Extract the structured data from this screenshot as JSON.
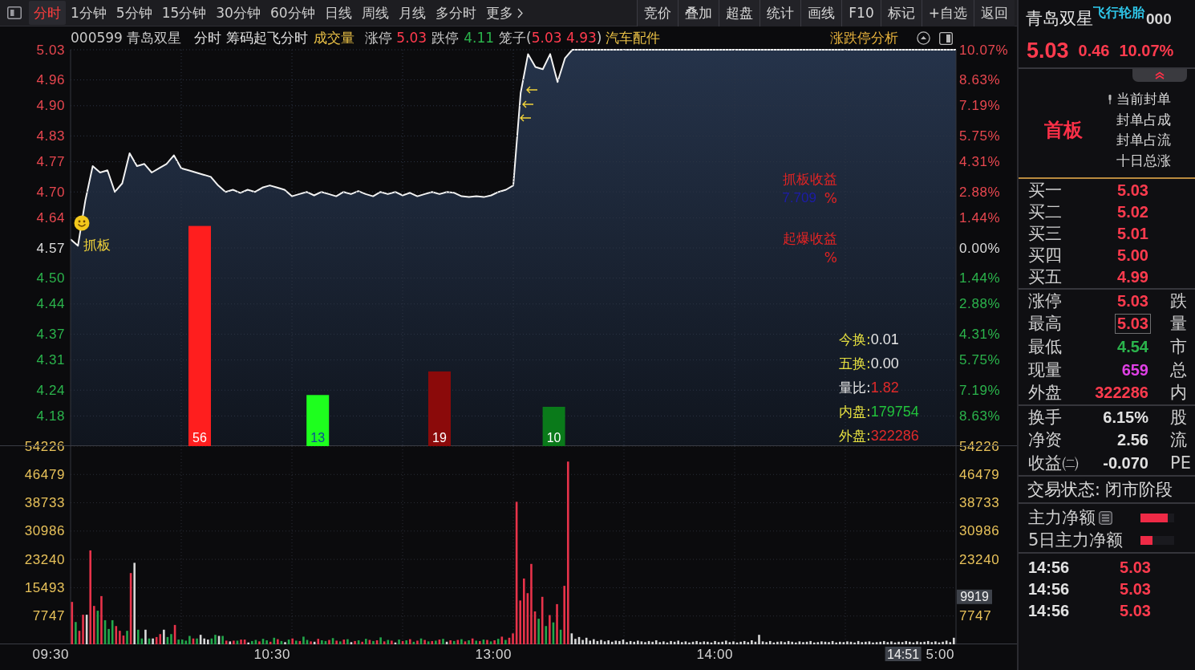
{
  "toolbar": {
    "periods": [
      {
        "label": "分时",
        "selected": true,
        "kind": "period"
      },
      {
        "label": "1分钟",
        "selected": false,
        "kind": "period"
      },
      {
        "label": "5分钟",
        "selected": false,
        "kind": "period"
      },
      {
        "label": "15分钟",
        "selected": false,
        "kind": "period"
      },
      {
        "label": "30分钟",
        "selected": false,
        "kind": "period"
      },
      {
        "label": "60分钟",
        "selected": false,
        "kind": "period"
      },
      {
        "label": "日线",
        "selected": false,
        "kind": "period"
      },
      {
        "label": "周线",
        "selected": false,
        "kind": "period"
      },
      {
        "label": "月线",
        "selected": false,
        "kind": "period"
      },
      {
        "label": "多分时",
        "selected": false,
        "kind": "period"
      },
      {
        "label": "更多",
        "selected": false,
        "kind": "menu"
      }
    ],
    "actions": [
      "竞价",
      "叠加",
      "超盘",
      "统计",
      "画线",
      "F10",
      "标记",
      "+自选",
      "返回"
    ]
  },
  "chart_header": {
    "code_name": "000599 青岛双星",
    "period": "分时",
    "indicator": "筹码起飞分时",
    "volume_label": "成交量",
    "limit_up_label": "涨停",
    "limit_up": "5.03",
    "limit_down_label": "跌停",
    "limit_down": "4.11",
    "cage": {
      "open": "笼子(",
      "high": "5.03",
      "low": "4.93",
      "close": ")"
    },
    "industry": "汽车配件",
    "analysis": "涨跌停分析"
  },
  "price_chart": {
    "chart_data": {
      "type": "area",
      "grid": true,
      "ylim": [
        4.11,
        5.03
      ],
      "yticks": [
        {
          "value": 5.03,
          "label": "5.03"
        },
        {
          "value": 4.96,
          "label": "4.96"
        },
        {
          "value": 4.9,
          "label": "4.90"
        },
        {
          "value": 4.83,
          "label": "4.83"
        },
        {
          "value": 4.77,
          "label": "4.77"
        },
        {
          "value": 4.7,
          "label": "4.70"
        },
        {
          "value": 4.64,
          "label": "4.64"
        },
        {
          "value": 4.57,
          "label": "4.57"
        },
        {
          "value": 4.5,
          "label": "4.50"
        },
        {
          "value": 4.44,
          "label": "4.44"
        },
        {
          "value": 4.37,
          "label": "4.37"
        },
        {
          "value": 4.31,
          "label": "4.31"
        },
        {
          "value": 4.24,
          "label": "4.24"
        },
        {
          "value": 4.18,
          "label": "4.18"
        }
      ],
      "values": [
        4.59,
        4.575,
        4.68,
        4.76,
        4.745,
        4.75,
        4.7,
        4.72,
        4.79,
        4.76,
        4.765,
        4.745,
        4.755,
        4.765,
        4.785,
        4.755,
        4.75,
        4.745,
        4.74,
        4.735,
        4.715,
        4.7,
        4.705,
        4.698,
        4.705,
        4.7,
        4.71,
        4.715,
        4.71,
        4.705,
        4.69,
        4.695,
        4.7,
        4.692,
        4.7,
        4.695,
        4.69,
        4.7,
        4.695,
        4.702,
        4.695,
        4.69,
        4.7,
        4.695,
        4.7,
        4.692,
        4.698,
        4.69,
        4.695,
        4.7,
        4.695,
        4.7,
        4.698,
        4.69,
        4.688,
        4.69,
        4.688,
        4.692,
        4.7,
        4.705,
        4.715,
        4.93,
        5.02,
        4.99,
        4.985,
        5.02,
        4.955,
        5.01,
        5.03,
        5.03,
        5.03,
        5.03,
        5.03,
        5.03,
        5.03,
        5.03,
        5.03,
        5.03,
        5.03,
        5.03,
        5.03,
        5.03,
        5.03,
        5.03,
        5.03,
        5.03,
        5.03,
        5.03,
        5.03,
        5.03,
        5.03,
        5.03,
        5.03,
        5.03,
        5.03,
        5.03,
        5.03,
        5.03,
        5.03,
        5.03,
        5.03,
        5.03,
        5.03,
        5.03,
        5.03,
        5.03,
        5.03,
        5.03,
        5.03,
        5.03,
        5.03,
        5.03,
        5.03,
        5.03,
        5.03,
        5.03,
        5.03,
        5.03,
        5.03,
        5.03,
        5.03
      ]
    },
    "percent_ticks": [
      {
        "label": "10.07%",
        "kind": "up"
      },
      {
        "label": "8.63%",
        "kind": "up"
      },
      {
        "label": "7.19%",
        "kind": "up"
      },
      {
        "label": "5.75%",
        "kind": "up"
      },
      {
        "label": "4.31%",
        "kind": "up"
      },
      {
        "label": "2.88%",
        "kind": "up"
      },
      {
        "label": "1.44%",
        "kind": "up"
      },
      {
        "label": "0.00%",
        "kind": "flat"
      },
      {
        "label": "1.44%",
        "kind": "down"
      },
      {
        "label": "2.88%",
        "kind": "down"
      },
      {
        "label": "4.31%",
        "kind": "down"
      },
      {
        "label": "5.75%",
        "kind": "down"
      },
      {
        "label": "7.19%",
        "kind": "down"
      },
      {
        "label": "8.63%",
        "kind": "down"
      }
    ],
    "signal_bars": [
      {
        "value": "56",
        "color": "#ff1e1e"
      },
      {
        "value": "13",
        "color": "#1eff1e"
      },
      {
        "value": "19",
        "color": "#8b0a0a"
      },
      {
        "value": "10",
        "color": "#0a7a1a"
      }
    ],
    "entry_marker": {
      "label": "抓板"
    },
    "yields": [
      {
        "label": "抓板收益",
        "value": "7.709",
        "unit": "%"
      },
      {
        "label": "起爆收益",
        "unit": "%"
      }
    ],
    "info": [
      {
        "label": "今换:",
        "value": "0.01",
        "kind": "turnover",
        "color": "#e6e6e6"
      },
      {
        "label": "五换:",
        "value": "0.00",
        "kind": "turnover",
        "color": "#e6e6e6"
      },
      {
        "label": "量比:",
        "value": "1.82",
        "kind": "ratio",
        "color": "#e02a2a"
      },
      {
        "label": "内盘:",
        "value": "179754",
        "kind": "volume",
        "color": "#22c23c"
      },
      {
        "label": "外盘:",
        "value": "322286",
        "kind": "volume",
        "color": "#e02a2a"
      }
    ]
  },
  "volume_chart": {
    "chart_data": {
      "type": "bar",
      "stacked": true,
      "grid": true,
      "ylim": [
        0,
        54226
      ],
      "yticks": [
        54226,
        46479,
        38733,
        30986,
        23240,
        15493,
        7747
      ],
      "series": [
        {
          "color": "#e8334a",
          "values": [
            11600,
            0,
            3700,
            8100,
            0,
            25700,
            10500,
            0,
            13200,
            0,
            0,
            0,
            5000,
            3700,
            2400,
            0,
            19500,
            0,
            0,
            0,
            0,
            0,
            0,
            2000,
            2800,
            0,
            0,
            0,
            5300,
            0,
            0,
            0,
            0,
            1600,
            0,
            0,
            0,
            0,
            0,
            0,
            0,
            0,
            1000,
            0,
            1000,
            0,
            1300,
            1300,
            0,
            0,
            0,
            800,
            0,
            0,
            700,
            0,
            1400,
            0,
            0,
            0,
            1600,
            0,
            900,
            0,
            0,
            800,
            0,
            1500,
            0,
            0,
            1200,
            0,
            1000,
            0,
            1300,
            0,
            0,
            900,
            0,
            700,
            0,
            1200,
            0,
            1100,
            0,
            800,
            0,
            1000,
            0,
            0,
            900,
            0,
            1400,
            0,
            1000,
            0,
            1200,
            0,
            900,
            0,
            1300,
            0,
            0,
            1100,
            0,
            1200,
            0,
            800,
            0,
            1600,
            0,
            900,
            0,
            1200,
            0,
            1100,
            0,
            2100,
            0,
            1800,
            3000,
            39000,
            12000,
            18000,
            14000,
            22000,
            9000,
            0,
            13000,
            0,
            8000,
            0,
            11000,
            0,
            16000,
            50000,
            0,
            0,
            0,
            0,
            0,
            0,
            0,
            0,
            0,
            0,
            0,
            0,
            0,
            0,
            0,
            0,
            0,
            0,
            0,
            0,
            0,
            0,
            0,
            0,
            0,
            0,
            0,
            0,
            0,
            0,
            0,
            0,
            0,
            0,
            0,
            0,
            0,
            0,
            0,
            0,
            0,
            0,
            0,
            0,
            0,
            0,
            0,
            0,
            0,
            0,
            0,
            0,
            0,
            0,
            0,
            0,
            0,
            0,
            0,
            0,
            0,
            0,
            0,
            0,
            0,
            0,
            0,
            0,
            0,
            0,
            0,
            0,
            0,
            0,
            0,
            0,
            0,
            0,
            0,
            0,
            0,
            0,
            0,
            0,
            0,
            0,
            0,
            0,
            0,
            0,
            0,
            0,
            0,
            0,
            0,
            0,
            0,
            0,
            0,
            0,
            0,
            0,
            0,
            0,
            0
          ]
        },
        {
          "color": "#23a84b",
          "values": [
            0,
            6100,
            0,
            0,
            0,
            0,
            0,
            9200,
            0,
            6600,
            4200,
            6600,
            0,
            0,
            0,
            3700,
            0,
            0,
            4000,
            1600,
            0,
            1600,
            0,
            0,
            0,
            0,
            2000,
            2800,
            0,
            1300,
            1300,
            1000,
            2300,
            0,
            1600,
            0,
            0,
            0,
            1600,
            2600,
            0,
            2300,
            0,
            0,
            0,
            1000,
            0,
            0,
            0,
            900,
            1200,
            0,
            1500,
            1100,
            0,
            1800,
            0,
            900,
            0,
            1300,
            0,
            1000,
            0,
            2100,
            1200,
            0,
            0,
            0,
            1100,
            900,
            0,
            1700,
            0,
            800,
            0,
            1400,
            0,
            0,
            1100,
            0,
            1500,
            0,
            900,
            0,
            1900,
            0,
            1200,
            0,
            0,
            1300,
            0,
            1100,
            0,
            700,
            0,
            1600,
            0,
            800,
            0,
            1000,
            0,
            1500,
            0,
            0,
            900,
            0,
            1400,
            0,
            1100,
            0,
            1000,
            0,
            1300,
            0,
            800,
            0,
            1500,
            0,
            1200,
            0,
            0,
            0,
            0,
            0,
            0,
            0,
            0,
            7000,
            0,
            5000,
            0,
            6000,
            0,
            4000,
            0,
            0,
            0,
            0,
            0,
            0,
            0,
            0,
            0,
            0,
            0,
            0,
            0,
            0,
            0,
            0,
            0,
            0,
            0,
            0,
            0,
            0,
            0,
            0,
            0,
            0,
            0,
            0,
            0,
            0,
            0,
            0,
            0,
            0,
            0,
            0,
            0,
            0,
            0,
            0,
            0,
            0,
            0,
            0,
            0,
            0,
            0,
            0,
            0,
            0,
            0,
            0,
            0,
            0,
            0,
            0,
            0,
            0,
            0,
            0,
            0,
            0,
            0,
            0,
            0,
            0,
            0,
            0,
            0,
            0,
            0,
            0,
            0,
            0,
            0,
            0,
            0,
            0,
            0,
            0,
            0,
            0,
            0,
            0,
            0,
            0,
            0,
            0,
            0,
            0,
            0,
            0,
            0,
            0,
            0,
            0,
            0,
            0,
            0,
            0,
            0,
            0,
            0,
            0,
            0,
            0,
            0
          ]
        },
        {
          "color": "#d8d8d8",
          "values": [
            0,
            0,
            0,
            0,
            8100,
            0,
            0,
            0,
            0,
            0,
            0,
            0,
            0,
            0,
            0,
            0,
            0,
            22300,
            0,
            0,
            4000,
            0,
            1600,
            0,
            0,
            4000,
            0,
            0,
            0,
            0,
            0,
            0,
            0,
            0,
            0,
            2600,
            1600,
            1300,
            0,
            0,
            2300,
            0,
            0,
            800,
            0,
            0,
            0,
            0,
            500,
            0,
            0,
            0,
            0,
            0,
            0,
            0,
            0,
            0,
            600,
            0,
            0,
            0,
            0,
            0,
            0,
            0,
            700,
            0,
            0,
            0,
            0,
            0,
            0,
            0,
            0,
            0,
            600,
            0,
            0,
            0,
            0,
            0,
            0,
            0,
            0,
            0,
            0,
            0,
            500,
            0,
            0,
            0,
            0,
            0,
            0,
            0,
            0,
            0,
            0,
            0,
            0,
            0,
            700,
            0,
            0,
            0,
            0,
            0,
            0,
            0,
            0,
            0,
            0,
            0,
            0,
            0,
            0,
            0,
            0,
            0,
            0,
            0,
            0,
            0,
            0,
            0,
            0,
            0,
            0,
            0,
            0,
            0,
            0,
            0,
            0,
            0,
            3000,
            1500,
            2000,
            1200,
            1800,
            1000,
            1400,
            900,
            1200,
            800,
            1100,
            700,
            1000,
            900,
            1300,
            600,
            900,
            700,
            1000,
            800,
            600,
            900,
            700,
            1100,
            600,
            800,
            500,
            900,
            700,
            1000,
            600,
            800,
            500,
            700,
            900,
            600,
            800,
            700,
            500,
            900,
            600,
            700,
            1000,
            600,
            800,
            500,
            700,
            900,
            600,
            1100,
            700,
            2600,
            800,
            600,
            900,
            500,
            700,
            800,
            600,
            900,
            700,
            500,
            800,
            600,
            700,
            900,
            500,
            600,
            800,
            700,
            600,
            900,
            500,
            700,
            600,
            800,
            700,
            500,
            900,
            600,
            700,
            800,
            500,
            600,
            700,
            900,
            600,
            800,
            500,
            700,
            600,
            900,
            700,
            500,
            800,
            600,
            700,
            900,
            600,
            800,
            500,
            700,
            1000,
            600,
            1800
          ]
        }
      ]
    },
    "right_ticks": [
      "54226",
      "46479",
      "38733",
      "30986",
      "23240",
      "7747"
    ],
    "crosshair": {
      "time": "14:51",
      "volume": "9919"
    }
  },
  "time_axis": {
    "labels": [
      "09:30",
      "10:30",
      "13:00",
      "14:00",
      "5:00"
    ]
  },
  "quote_panel": {
    "name": "青岛双星",
    "concept": "飞行轮胎",
    "code": "000",
    "price": "5.03",
    "change": "0.46",
    "change_pct": "10.07%",
    "board_tag": "首板",
    "seal_info": [
      "当前封单",
      "封单占成",
      "封单占流",
      "十日总涨"
    ],
    "bids": [
      {
        "label": "买一",
        "price": "5.03"
      },
      {
        "label": "买二",
        "price": "5.02"
      },
      {
        "label": "买三",
        "price": "5.01"
      },
      {
        "label": "买四",
        "price": "5.00"
      },
      {
        "label": "买五",
        "price": "4.99"
      }
    ],
    "stats": [
      {
        "label": "涨停",
        "value": "5.03",
        "color": "#ff3b4e",
        "boxed": false,
        "side": "跌"
      },
      {
        "label": "最高",
        "value": "5.03",
        "color": "#ff3b4e",
        "boxed": true,
        "side": "量"
      },
      {
        "label": "最低",
        "value": "4.54",
        "color": "#2bb44c",
        "boxed": false,
        "side": "市"
      },
      {
        "label": "现量",
        "value": "659",
        "color": "#e040e6",
        "boxed": false,
        "side": "总"
      },
      {
        "label": "外盘",
        "value": "322286",
        "color": "#ff3b4e",
        "boxed": false,
        "side": "内"
      }
    ],
    "fundamentals": [
      {
        "label": "换手",
        "value": "6.15%",
        "side": "股"
      },
      {
        "label": "净资",
        "value": "2.56",
        "side": "流"
      },
      {
        "label": "收益㈡",
        "value": "-0.070",
        "side": "PE"
      }
    ],
    "trade_status": "交易状态: 闭市阶段",
    "flows": [
      {
        "label": "主力净额",
        "detail_icon": true,
        "level": 0.8
      },
      {
        "label": "5日主力净额",
        "detail_icon": false,
        "level": 0.36
      }
    ],
    "ticks": [
      {
        "time": "14:56",
        "price": "5.03"
      },
      {
        "time": "14:56",
        "price": "5.03"
      },
      {
        "time": "14:56",
        "price": "5.03"
      }
    ]
  }
}
